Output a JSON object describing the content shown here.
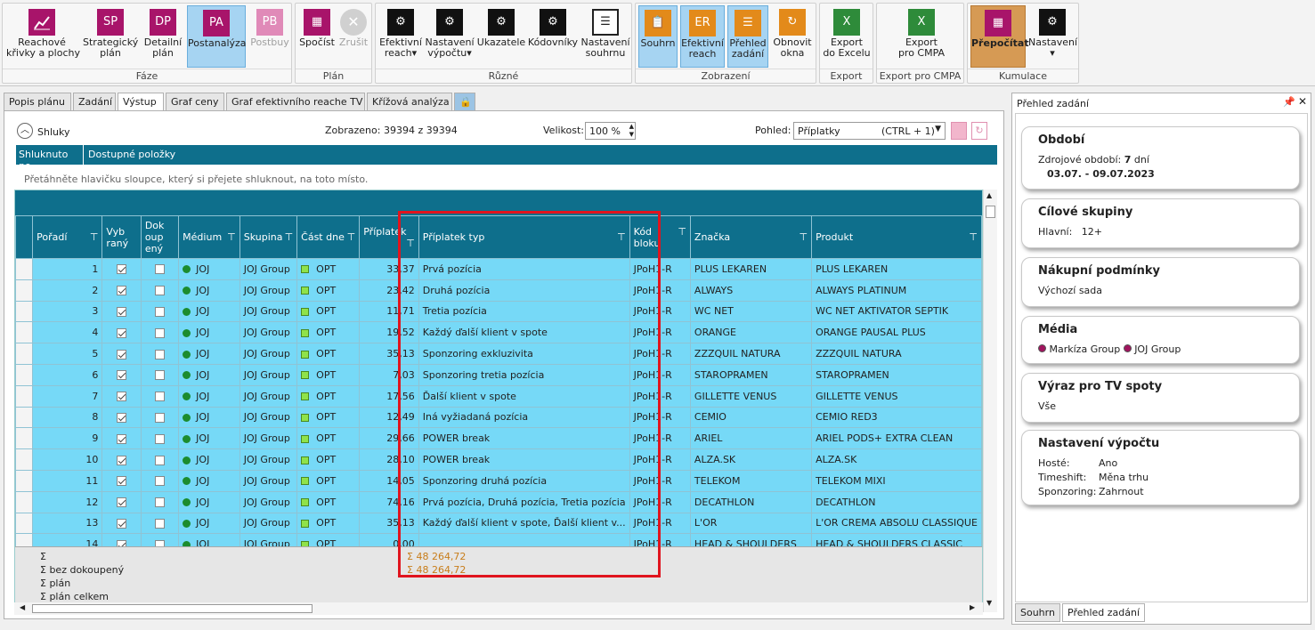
{
  "ribbon": {
    "faze": {
      "caption": "Fáze",
      "buttons": [
        {
          "label1": "Reachové",
          "label2": "křivky a plochy"
        },
        {
          "icon_text": "SP",
          "label1": "Strategický",
          "label2": "plán"
        },
        {
          "icon_text": "DP",
          "label1": "Detailní",
          "label2": "plán"
        },
        {
          "icon_text": "PA",
          "label1": "Postanalýza"
        },
        {
          "icon_text": "PB",
          "label1": "Postbuy"
        }
      ]
    },
    "plan": {
      "caption": "Plán",
      "buttons": [
        {
          "label1": "Spočíst"
        },
        {
          "label1": "Zrušit"
        }
      ]
    },
    "ruzne": {
      "caption": "Různé",
      "buttons": [
        {
          "label1": "Efektivní",
          "label2": "reach▾"
        },
        {
          "label1": "Nastavení",
          "label2": "výpočtu▾"
        },
        {
          "label1": "Ukazatele"
        },
        {
          "label1": "Kódovníky"
        },
        {
          "label1": "Nastavení",
          "label2": "souhrnu"
        }
      ]
    },
    "zobrazeni": {
      "caption": "Zobrazení",
      "buttons": [
        {
          "label1": "Souhrn"
        },
        {
          "icon_text": "ER",
          "label1": "Efektivní",
          "label2": "reach"
        },
        {
          "label1": "Přehled",
          "label2": "zadání"
        },
        {
          "label1": "Obnovit",
          "label2": "okna"
        }
      ]
    },
    "export": {
      "caption": "Export",
      "buttons": [
        {
          "label1": "Export",
          "label2": "do Excelu"
        }
      ]
    },
    "export_cmpa": {
      "caption": "Export pro CMPA",
      "buttons": [
        {
          "label1": "Export",
          "label2": "pro CMPA"
        }
      ]
    },
    "kumulace": {
      "caption": "Kumulace",
      "buttons": [
        {
          "label1": "Přepočítat"
        },
        {
          "label1": "Nastavení",
          "label2": "▾"
        }
      ]
    }
  },
  "tabs": [
    "Popis plánu",
    "Zadání",
    "Výstup",
    "Graf ceny",
    "Graf efektivního reache TV",
    "Křížová analýza"
  ],
  "toolbar": {
    "shluky": "Shluky",
    "zobrazeno": "Zobrazeno: 39394 z 39394",
    "velikost_label": "Velikost:",
    "velikost_value": "100 %",
    "pohled_label": "Pohled:",
    "pohled_value": "Příplatky",
    "pohled_shortcut": "(CTRL + 1)"
  },
  "group_bar": {
    "shluknuto": "Shluknuto po",
    "dostupne": "Dostupné položky",
    "hint": "Přetáhněte hlavičku sloupce, který si přejete shluknout, na toto místo."
  },
  "columns": [
    {
      "l1": "Pořadí"
    },
    {
      "l1": "Vyb",
      "l2": "raný"
    },
    {
      "l1": "Dok",
      "l2": "oup",
      "l3": "ený"
    },
    {
      "l1": "Médium"
    },
    {
      "l1": "Skupina"
    },
    {
      "l1": "Část dne"
    },
    {
      "l1": "Příplatek"
    },
    {
      "l1": "Příplatek typ"
    },
    {
      "l1": "Kód",
      "l2": "bloku"
    },
    {
      "l1": "Značka"
    },
    {
      "l1": "Produkt"
    }
  ],
  "rows": [
    {
      "n": "1",
      "vyb": true,
      "dok": false,
      "medium": "JOJ",
      "skupina": "JOJ Group",
      "cast": "OPT",
      "priplatek": "33,37",
      "typ": "Prvá pozícia",
      "kod": "JPoH1-R",
      "znacka": "PLUS LEKAREN",
      "produkt": "PLUS LEKAREN"
    },
    {
      "n": "2",
      "vyb": true,
      "dok": false,
      "medium": "JOJ",
      "skupina": "JOJ Group",
      "cast": "OPT",
      "priplatek": "23,42",
      "typ": "Druhá pozícia",
      "kod": "JPoH1-R",
      "znacka": "ALWAYS",
      "produkt": "ALWAYS PLATINUM"
    },
    {
      "n": "3",
      "vyb": true,
      "dok": false,
      "medium": "JOJ",
      "skupina": "JOJ Group",
      "cast": "OPT",
      "priplatek": "11,71",
      "typ": "Tretia pozícia",
      "kod": "JPoH1-R",
      "znacka": "WC NET",
      "produkt": "WC NET AKTIVATOR SEPTIK"
    },
    {
      "n": "4",
      "vyb": true,
      "dok": false,
      "medium": "JOJ",
      "skupina": "JOJ Group",
      "cast": "OPT",
      "priplatek": "19,52",
      "typ": "Každý ďalší klient v spote",
      "kod": "JPoH1-R",
      "znacka": "ORANGE",
      "produkt": "ORANGE PAUSAL PLUS"
    },
    {
      "n": "5",
      "vyb": true,
      "dok": false,
      "medium": "JOJ",
      "skupina": "JOJ Group",
      "cast": "OPT",
      "priplatek": "35,13",
      "typ": "Sponzoring exkluzivita",
      "kod": "JPoH1-R",
      "znacka": "ZZZQUIL NATURA",
      "produkt": "ZZZQUIL NATURA"
    },
    {
      "n": "6",
      "vyb": true,
      "dok": false,
      "medium": "JOJ",
      "skupina": "JOJ Group",
      "cast": "OPT",
      "priplatek": "7,03",
      "typ": "Sponzoring tretia pozícia",
      "kod": "JPoH1-R",
      "znacka": "STAROPRAMEN",
      "produkt": "STAROPRAMEN"
    },
    {
      "n": "7",
      "vyb": true,
      "dok": false,
      "medium": "JOJ",
      "skupina": "JOJ Group",
      "cast": "OPT",
      "priplatek": "17,56",
      "typ": "Ďalší klient v spote",
      "kod": "JPoH1-R",
      "znacka": "GILLETTE VENUS",
      "produkt": "GILLETTE VENUS"
    },
    {
      "n": "8",
      "vyb": true,
      "dok": false,
      "medium": "JOJ",
      "skupina": "JOJ Group",
      "cast": "OPT",
      "priplatek": "12,49",
      "typ": "Iná vyžiadaná pozícia",
      "kod": "JPoH1-R",
      "znacka": "CEMIO",
      "produkt": "CEMIO RED3"
    },
    {
      "n": "9",
      "vyb": true,
      "dok": false,
      "medium": "JOJ",
      "skupina": "JOJ Group",
      "cast": "OPT",
      "priplatek": "29,66",
      "typ": "POWER break",
      "kod": "JPoH1-R",
      "znacka": "ARIEL",
      "produkt": "ARIEL PODS+ EXTRA CLEAN"
    },
    {
      "n": "10",
      "vyb": true,
      "dok": false,
      "medium": "JOJ",
      "skupina": "JOJ Group",
      "cast": "OPT",
      "priplatek": "28,10",
      "typ": "POWER break",
      "kod": "JPoH1-R",
      "znacka": "ALZA.SK",
      "produkt": "ALZA.SK"
    },
    {
      "n": "11",
      "vyb": true,
      "dok": false,
      "medium": "JOJ",
      "skupina": "JOJ Group",
      "cast": "OPT",
      "priplatek": "14,05",
      "typ": "Sponzoring druhá pozícia",
      "kod": "JPoH1-R",
      "znacka": "TELEKOM",
      "produkt": "TELEKOM MIXI"
    },
    {
      "n": "12",
      "vyb": true,
      "dok": false,
      "medium": "JOJ",
      "skupina": "JOJ Group",
      "cast": "OPT",
      "priplatek": "74,16",
      "typ": "Prvá pozícia, Druhá pozícia, Tretia pozícia",
      "kod": "JPoH1-R",
      "znacka": "DECATHLON",
      "produkt": "DECATHLON"
    },
    {
      "n": "13",
      "vyb": true,
      "dok": false,
      "medium": "JOJ",
      "skupina": "JOJ Group",
      "cast": "OPT",
      "priplatek": "35,13",
      "typ": "Každý ďalší klient v spote, Ďalší klient v...",
      "kod": "JPoH1-R",
      "znacka": "L'OR",
      "produkt": "L'OR CREMA ABSOLU CLASSIQUE"
    },
    {
      "n": "14",
      "vyb": true,
      "dok": false,
      "medium": "JOJ",
      "skupina": "JOJ Group",
      "cast": "OPT",
      "priplatek": "0,00",
      "typ": "",
      "kod": "JPoH1-R",
      "znacka": "HEAD & SHOULDERS",
      "produkt": "HEAD & SHOULDERS CLASSIC"
    }
  ],
  "summary": {
    "labels": [
      "Σ",
      "Σ bez dokoupený",
      "Σ plán",
      "Σ plán celkem"
    ],
    "priplatek_1": "Σ 48 264,72",
    "priplatek_2": "Σ 48 264,72"
  },
  "right_panel": {
    "title": "Přehled zadání",
    "cards": {
      "obdobi": {
        "title": "Období",
        "line1_label": "Zdrojové období:",
        "line1_value": "7",
        "line1_unit": "dní",
        "line2": "03.07. - 09.07.2023"
      },
      "cilove": {
        "title": "Cílové skupiny",
        "line1": "Hlavní:   12+"
      },
      "nakupni": {
        "title": "Nákupní podmínky",
        "line1": "Výchozí sada"
      },
      "media": {
        "title": "Média",
        "item1": "Markíza Group",
        "item2": "JOJ Group"
      },
      "vyraz": {
        "title": "Výraz pro TV spoty",
        "line1": "Vše"
      },
      "nastaveni": {
        "title": "Nastavení výpočtu",
        "k1": "Hosté:",
        "v1": "Ano",
        "k2": "Timeshift:",
        "v2": "Měna trhu",
        "k3": "Sponzoring:",
        "v3": "Zahrnout"
      }
    },
    "bottom_tabs": [
      "Souhrn",
      "Přehled zadání"
    ]
  },
  "colors": {
    "accent": "#0e6f8c",
    "row": "#76d9f7",
    "highlight": "#e0141e",
    "sum_text": "#c87d1a"
  }
}
